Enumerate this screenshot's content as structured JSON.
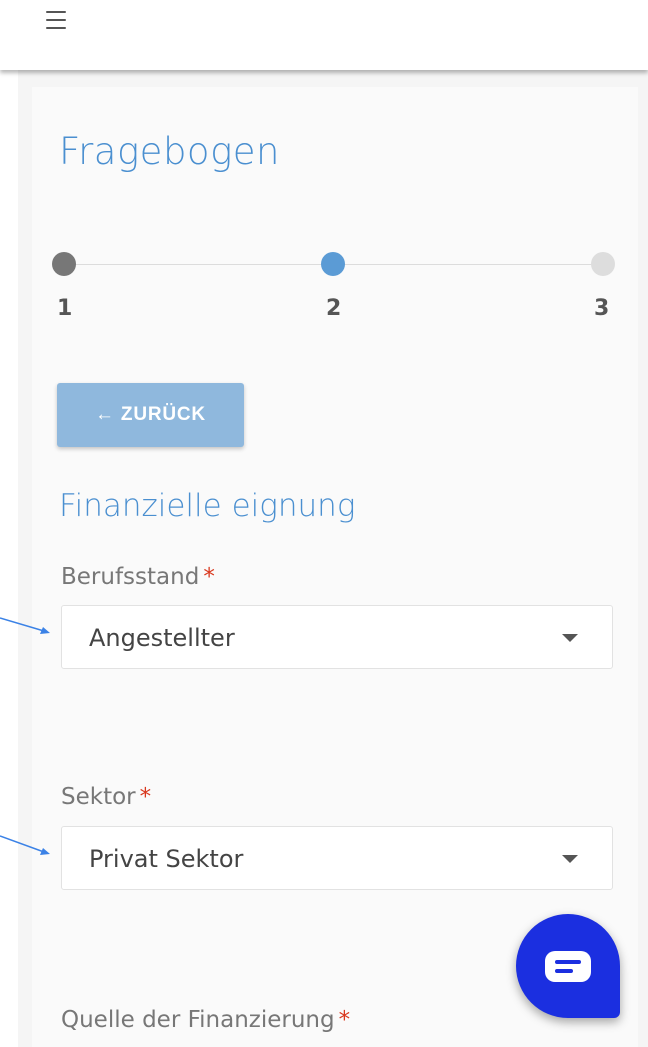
{
  "header": {
    "menu_icon": "hamburger-icon"
  },
  "page": {
    "title": "Fragebogen"
  },
  "stepper": {
    "steps": [
      {
        "label": "1",
        "state": "done"
      },
      {
        "label": "2",
        "state": "active"
      },
      {
        "label": "3",
        "state": "pending"
      }
    ],
    "colors": {
      "done": "#777777",
      "active": "#5b9bd5",
      "pending": "#dddddd"
    }
  },
  "back_button": {
    "label": "← ZURÜCK",
    "color": "#8fb8dd"
  },
  "section": {
    "title": "Finanzielle eignung"
  },
  "fields": [
    {
      "label": "Berufsstand",
      "required_mark": "*",
      "value": "Angestellter"
    },
    {
      "label": "Sektor",
      "required_mark": "*",
      "value": "Privat Sektor"
    },
    {
      "label": "Quelle der Finanzierung",
      "required_mark": "*"
    }
  ],
  "chat_widget": {
    "icon": "chat-icon",
    "color": "#1b2fe0"
  },
  "colors": {
    "accent": "#4a8fd0",
    "required": "#d9381e",
    "annotation_arrow": "#3b82e6"
  }
}
